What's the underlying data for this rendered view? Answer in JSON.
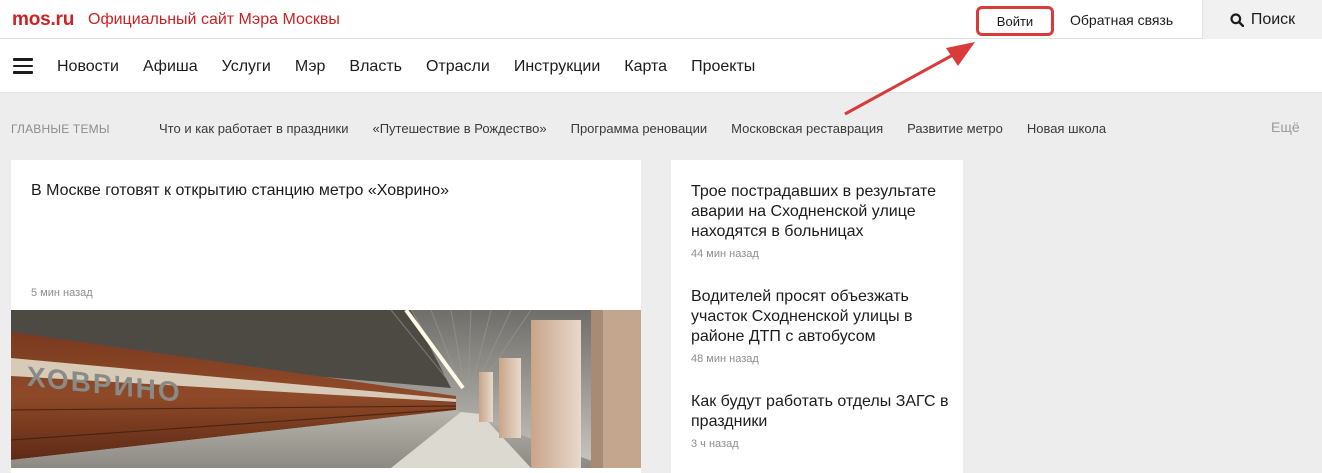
{
  "header": {
    "logo": "mos.ru",
    "site_title": "Официальный сайт Мэра Москвы",
    "login_label": "Войти",
    "feedback_label": "Обратная связь",
    "search_label": "Поиск"
  },
  "nav": {
    "items": [
      {
        "label": "Новости"
      },
      {
        "label": "Афиша"
      },
      {
        "label": "Услуги"
      },
      {
        "label": "Мэр"
      },
      {
        "label": "Власть"
      },
      {
        "label": "Отрасли"
      },
      {
        "label": "Инструкции"
      },
      {
        "label": "Карта"
      },
      {
        "label": "Проекты"
      }
    ]
  },
  "topics": {
    "label": "ГЛАВНЫЕ ТЕМЫ",
    "items": [
      {
        "label": "Что и как работает в праздники"
      },
      {
        "label": "«Путешествие в Рождество»"
      },
      {
        "label": "Программа реновации"
      },
      {
        "label": "Московская реставрация"
      },
      {
        "label": "Развитие метро"
      },
      {
        "label": "Новая школа"
      }
    ],
    "more_label": "Ещё"
  },
  "main_news": {
    "title": "В Москве готовят к открытию станцию метро «Ховрино»",
    "time": "5 мин назад",
    "image_sign": "ХОВРИНО"
  },
  "side_news": [
    {
      "title": "Трое пострадавших в результате аварии на Сходненской улице находятся в больницах",
      "time": "44 мин назад"
    },
    {
      "title": "Водителей просят объезжать участок Сходненской улицы в районе ДТП с автобусом",
      "time": "48 мин назад"
    },
    {
      "title": "Как будут работать отделы ЗАГС в праздники",
      "time": "3 ч назад"
    }
  ],
  "colors": {
    "brand": "#cc2222",
    "highlight": "#d93a3a",
    "background": "#ededed"
  }
}
